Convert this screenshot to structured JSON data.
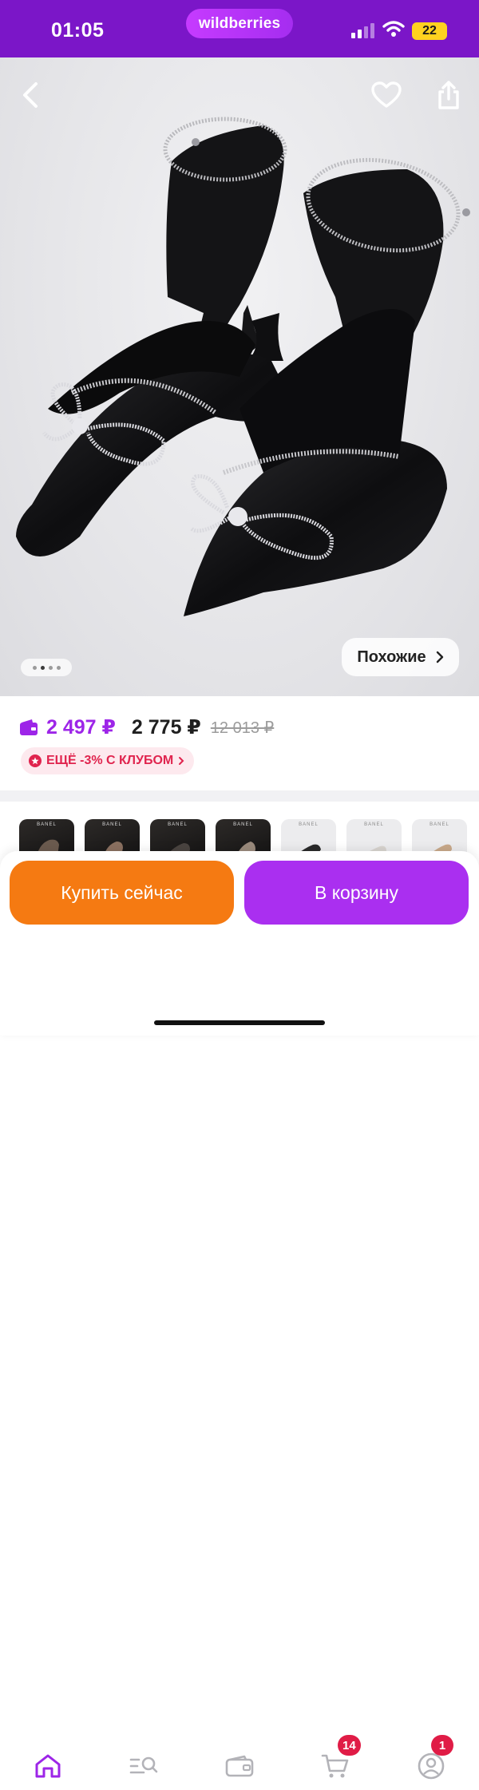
{
  "status_bar": {
    "time": "01:05",
    "battery": "22"
  },
  "brand": {
    "name": "wildberries"
  },
  "hero": {
    "similar_label": "Похожие",
    "image_dots": 4,
    "active_dot": 1
  },
  "price": {
    "current": "2 497 ₽",
    "regular": "2 775 ₽",
    "original": "12 013 ₽",
    "club_offer": "ЕЩЁ -3% С КЛУБОМ"
  },
  "thumbnails": [
    {
      "label": "BANEL",
      "style": "dark"
    },
    {
      "label": "BANEL",
      "style": "dark"
    },
    {
      "label": "BANEL",
      "style": "dark"
    },
    {
      "label": "BANEL",
      "style": "dark"
    },
    {
      "label": "BANEL",
      "style": "light"
    },
    {
      "label": "BANEL",
      "style": "light"
    },
    {
      "label": "BANEL",
      "style": "light"
    }
  ],
  "actions": {
    "buy_now": "Купить сейчас",
    "add_to_cart": "В корзину"
  },
  "tabbar": {
    "cart_badge": "14",
    "profile_badge": "1"
  },
  "colors": {
    "brand_purple": "#7b16c8",
    "accent_orange": "#f57a12",
    "accent_violet": "#aa2ff0",
    "badge_red": "#e01c46"
  }
}
